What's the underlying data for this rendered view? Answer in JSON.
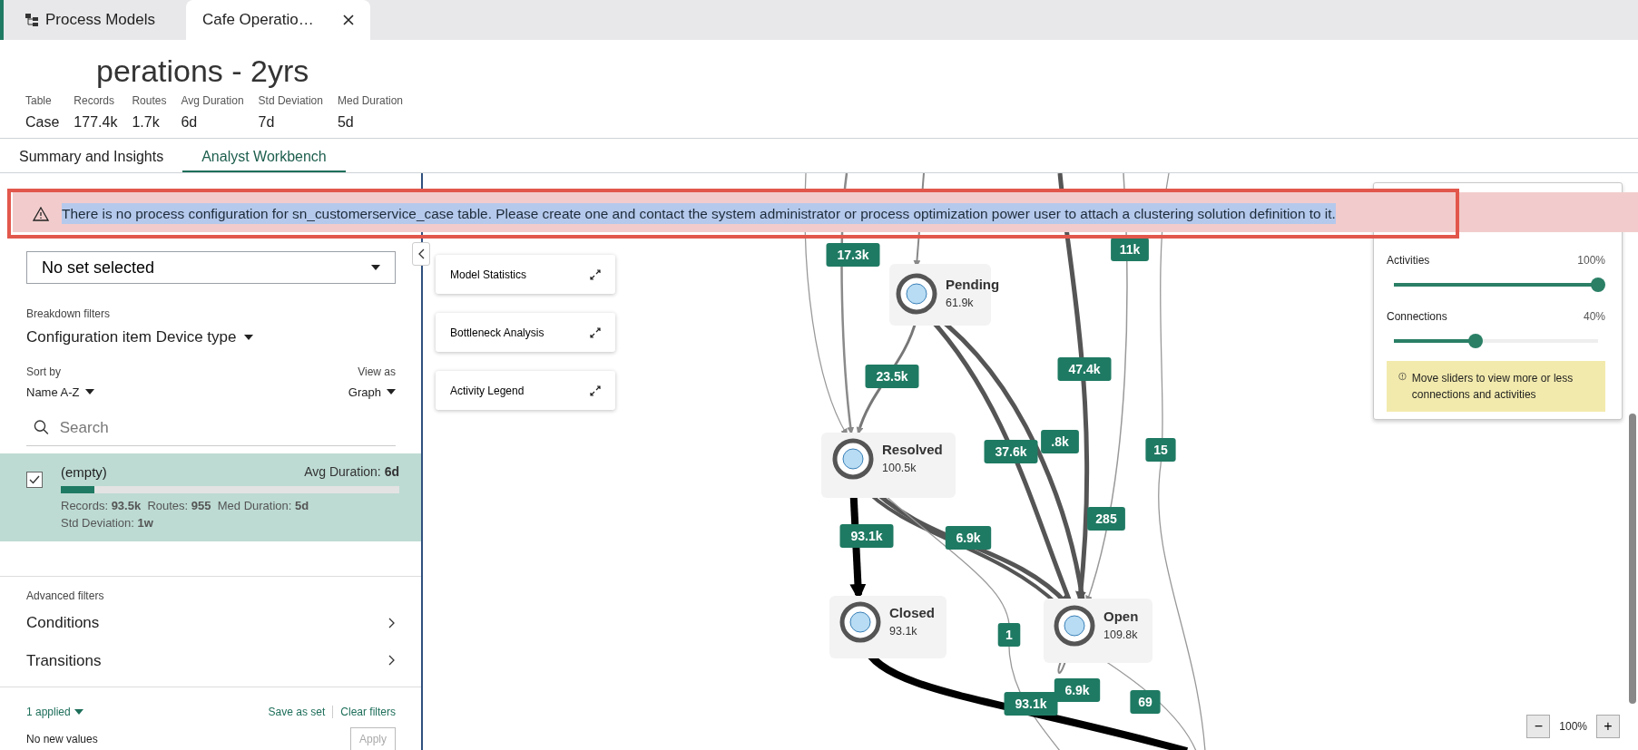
{
  "tabs": [
    {
      "label": "Process Models",
      "selected": false,
      "kind": "home"
    },
    {
      "label": "Cafe Operatio…",
      "selected": true,
      "kind": "document"
    }
  ],
  "header": {
    "title": "perations - 2yrs",
    "stats": [
      {
        "label": "Table",
        "value": "Case"
      },
      {
        "label": "Records",
        "value": "177.4k"
      },
      {
        "label": "Routes",
        "value": "1.7k"
      },
      {
        "label": "Avg Duration",
        "value": "6d"
      },
      {
        "label": "Std Deviation",
        "value": "7d"
      },
      {
        "label": "Med Duration",
        "value": "5d"
      }
    ]
  },
  "view_tabs": [
    {
      "label": "Summary and Insights",
      "selected": false
    },
    {
      "label": "Analyst Workbench",
      "selected": true
    }
  ],
  "banner": {
    "message": "There is no process configuration for sn_customerservice_case table. Please create one and contact the system administrator or process optimization power user to attach a clustering solution definition to it.",
    "highlighted": true
  },
  "filters": {
    "saved_filter": "No set selected",
    "breakdown_label": "Breakdown filters",
    "breakdown_value": "Configuration item Device type",
    "sort_label": "Sort by",
    "sort_value": "Name A-Z",
    "view_label": "View as",
    "view_value": "Graph",
    "search_placeholder": "Search",
    "items": [
      {
        "name": "(empty)",
        "avg": "Avg Duration: **6d**",
        "level": 0.1,
        "stats": "Records: **93.5k**  Routes: **955**  Med Duration: **5d**",
        "std": "Std Deviation: **1w**",
        "checked": true,
        "selected": true
      }
    ],
    "advanced_label": "Advanced filters",
    "advanced": [
      "Conditions",
      "Transitions"
    ],
    "applied": "1 applied",
    "save": "Save as set",
    "clear": "Clear filters",
    "status": "No new values",
    "apply": {
      "label": "Apply",
      "disabled": true
    }
  },
  "panels": [
    "Model Statistics",
    "Bottleneck Analysis",
    "Activity Legend"
  ],
  "graph": {
    "nodes": [
      {
        "name": "Pending",
        "count": "61.9k"
      },
      {
        "name": "Resolved",
        "count": "100.5k"
      },
      {
        "name": "Closed",
        "count": "93.1k"
      },
      {
        "name": "Open",
        "count": "109.8k"
      }
    ],
    "edges": [
      {
        "label": "17.3k"
      },
      {
        "label": "11k"
      },
      {
        "label": "23.5k"
      },
      {
        "label": "47.4k"
      },
      {
        "label": ".8k"
      },
      {
        "label": "37.6k"
      },
      {
        "label": "15"
      },
      {
        "label": "93.1k"
      },
      {
        "label": "6.9k"
      },
      {
        "label": "285"
      },
      {
        "label": "1"
      },
      {
        "label": "6.9k"
      },
      {
        "label": "93.1k"
      },
      {
        "label": "69"
      }
    ]
  },
  "sliders": [
    {
      "name": "Activities",
      "reading": "100%",
      "level": 1
    },
    {
      "name": "Connections",
      "reading": "40%",
      "level": 0.4
    }
  ],
  "hint": "Move sliders to view more or less connections and activities",
  "zoom": {
    "minus": "−",
    "reading": "100%",
    "plus": "+"
  }
}
